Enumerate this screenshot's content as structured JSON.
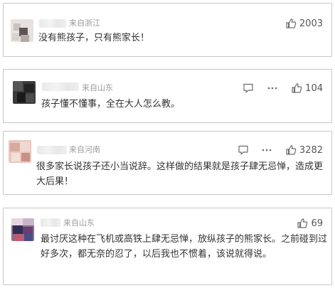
{
  "comments": [
    {
      "location": "来自浙江",
      "text": "没有熊孩子，只有熊家长！",
      "likes": "2003",
      "actions": [
        "like"
      ]
    },
    {
      "location": "来自山东",
      "text": "孩子懂不懂事，全在大人怎么教。",
      "likes": "104",
      "actions": [
        "reply",
        "more",
        "like"
      ]
    },
    {
      "location": "来自河南",
      "text": "很多家长说孩子还小当说辞。这样做的结果就是孩子肆无忌惮，造成更大后果！",
      "likes": "3282",
      "actions": [
        "reply",
        "more",
        "like"
      ]
    },
    {
      "location": "来自山东",
      "text": "最讨厌这种在飞机或高铁上肆无忌惮，放纵孩子的熊家长。之前碰到过好多次，都无奈的忍了，以后我也不惯着，该说就得说。",
      "likes": "69",
      "actions": [
        "like"
      ]
    }
  ],
  "colors": {
    "border": "#c8c8c8",
    "location_text": "#9a9a9a",
    "comment_text": "#333333",
    "icon": "#6b6b6b"
  },
  "icons": [
    "thumbs-up-icon",
    "comment-icon",
    "more-icon"
  ]
}
